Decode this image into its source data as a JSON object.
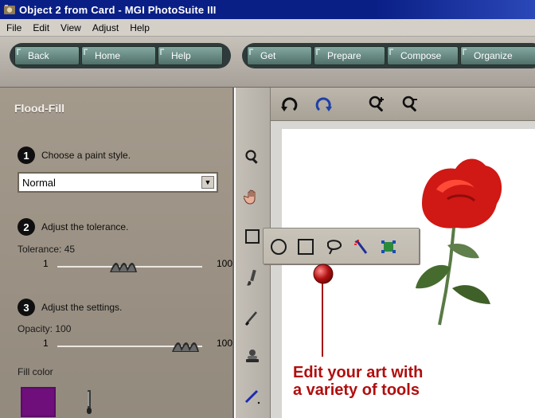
{
  "window": {
    "title": "Object 2 from Card - MGI PhotoSuite III"
  },
  "menu": {
    "items": [
      "File",
      "Edit",
      "View",
      "Adjust",
      "Help"
    ]
  },
  "nav": {
    "left_buttons": [
      "Back",
      "Home",
      "Help"
    ],
    "right_buttons": [
      "Get",
      "Prepare",
      "Compose",
      "Organize"
    ]
  },
  "panel": {
    "title": "Flood-Fill",
    "step1_num": "1",
    "step1_text": "Choose a paint style.",
    "paint_style": "Normal",
    "step2_num": "2",
    "step2_text": "Adjust the tolerance.",
    "tolerance_label": "Tolerance: 45",
    "tolerance_min": "1",
    "tolerance_max": "100",
    "tolerance_value": 45,
    "step3_num": "3",
    "step3_text": "Adjust the settings.",
    "opacity_label": "Opacity: 100",
    "opacity_min": "1",
    "opacity_max": "100",
    "opacity_value": 100,
    "fill_color_label": "Fill color",
    "fill_color_hex": "#6e0f7c"
  },
  "callout": {
    "line1": "Edit your art with",
    "line2": "a variety of tools",
    "color": "#b10e0e"
  },
  "icons": {
    "toolbar_top": [
      "rotate-left-icon",
      "rotate-right-icon",
      "zoom-in-icon",
      "zoom-out-icon"
    ],
    "tool_column": [
      "magnifier-icon",
      "hand-icon",
      "selection-rect-icon",
      "brush-icon",
      "pencil-icon",
      "stamp-icon",
      "line-tool-icon"
    ],
    "flyout": [
      "ellipse-select-icon",
      "rect-select-icon",
      "lasso-icon",
      "magic-wand-icon",
      "object-select-icon"
    ]
  }
}
